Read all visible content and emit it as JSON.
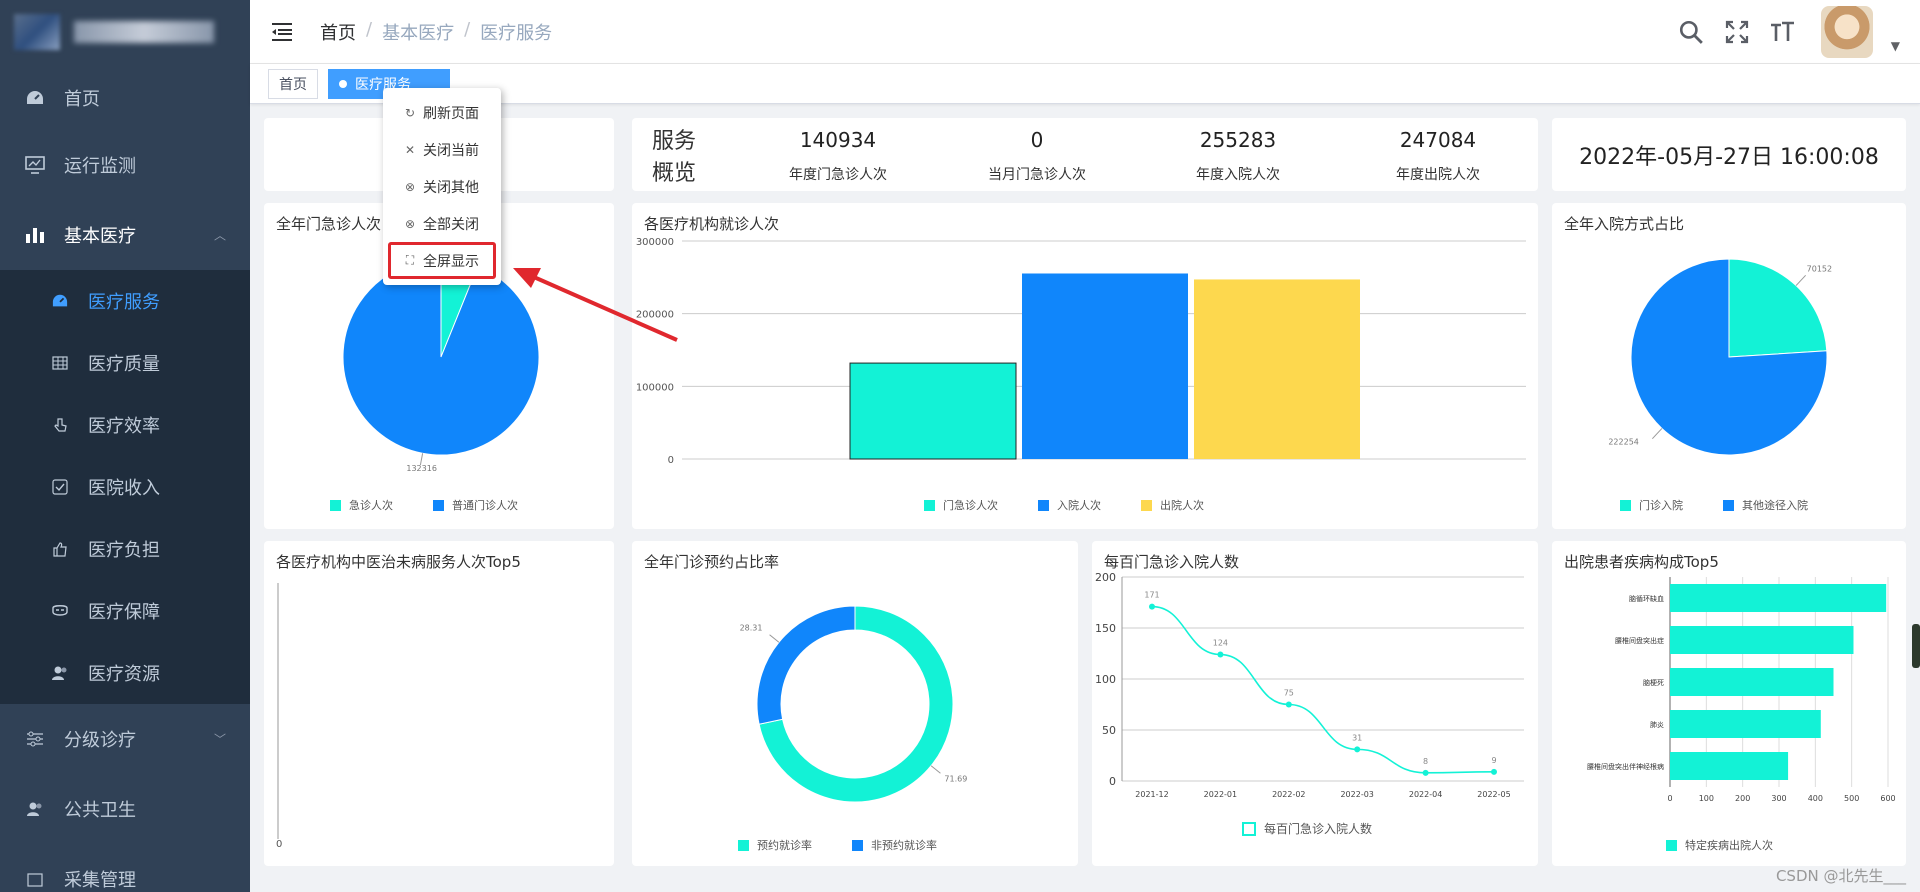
{
  "sidebar": {
    "items": [
      {
        "label": "首页"
      },
      {
        "label": "运行监测"
      },
      {
        "label": "基本医疗"
      },
      {
        "label": "分级诊疗"
      },
      {
        "label": "公共卫生"
      },
      {
        "label": "采集管理"
      }
    ],
    "submenu": [
      {
        "label": "医疗服务"
      },
      {
        "label": "医疗质量"
      },
      {
        "label": "医疗效率"
      },
      {
        "label": "医院收入"
      },
      {
        "label": "医疗负担"
      },
      {
        "label": "医疗保障"
      },
      {
        "label": "医疗资源"
      }
    ]
  },
  "header": {
    "breadcrumb": [
      "首页",
      "基本医疗",
      "医疗服务"
    ],
    "sep": "/"
  },
  "tags": [
    {
      "label": "首页"
    },
    {
      "label": "医疗服务"
    }
  ],
  "context_menu": [
    {
      "label": "刷新页面",
      "icon": "refresh-icon"
    },
    {
      "label": "关闭当前",
      "icon": "close-icon"
    },
    {
      "label": "关闭其他",
      "icon": "circle-close-icon"
    },
    {
      "label": "全部关闭",
      "icon": "circle-close-icon"
    },
    {
      "label": "全屏显示",
      "icon": "fullscreen-icon"
    }
  ],
  "overview": {
    "title": "服务概览",
    "stats": [
      {
        "value": "140934",
        "label": "年度门急诊人次"
      },
      {
        "value": "0",
        "label": "当月门急诊人次"
      },
      {
        "value": "255283",
        "label": "年度入院人次"
      },
      {
        "value": "247084",
        "label": "年度出院人次"
      }
    ]
  },
  "datetime": "2022年-05月-27日 16:00:08",
  "cards": {
    "c1": "全年门急诊人次占比",
    "c2": "各医疗机构就诊人次",
    "c3": "全年入院方式占比",
    "c4": "各医疗机构中医治未病服务人次Top5",
    "c5": "全年门诊预约占比率",
    "c6": "每百门急诊入院人数",
    "c7": "出院患者疾病构成Top5"
  },
  "chart_data": [
    {
      "type": "pie",
      "title": "全年门急诊人次占比",
      "labels": [
        "急诊人次",
        "普通门诊人次"
      ],
      "values": [
        8618,
        132316
      ],
      "label_shown": "132316",
      "colors": [
        "#13f2d6",
        "#1086fb"
      ]
    },
    {
      "type": "bar",
      "title": "各医疗机构就诊人次",
      "categories": [
        ""
      ],
      "series": [
        {
          "name": "门急诊人次",
          "values": [
            132000
          ]
        },
        {
          "name": "入院人次",
          "values": [
            255283
          ]
        },
        {
          "name": "出院人次",
          "values": [
            247084
          ]
        }
      ],
      "ylim": [
        0,
        300000
      ],
      "yticks": [
        "300000",
        "200000",
        "100000",
        "0"
      ],
      "colors": [
        "#13f2d6",
        "#1086fb",
        "#fdd84e"
      ]
    },
    {
      "type": "pie",
      "title": "全年入院方式占比",
      "labels": [
        "门诊入院",
        "其他途径入院"
      ],
      "values": [
        70152,
        222254
      ],
      "value_labels": [
        "70152",
        "222254"
      ],
      "colors": [
        "#13f2d6",
        "#1086fb"
      ]
    },
    {
      "type": "bar",
      "title": "各医疗机构中医治未病服务人次Top5",
      "values": [],
      "yticks": [
        "0"
      ]
    },
    {
      "type": "pie",
      "title": "全年门诊预约占比率",
      "labels": [
        "预约就诊率",
        "非预约就诊率"
      ],
      "values": [
        71.69,
        28.31
      ],
      "value_labels": [
        "71.69",
        "28.31"
      ],
      "colors": [
        "#13f2d6",
        "#1086fb"
      ]
    },
    {
      "type": "line",
      "title": "每百门急诊入院人数",
      "x": [
        "2021-12",
        "2022-01",
        "2022-02",
        "2022-03",
        "2022-04",
        "2022-05"
      ],
      "series": [
        {
          "name": "每百门急诊入院人数",
          "values": [
            171,
            124,
            75,
            31,
            8,
            9
          ]
        }
      ],
      "ylim": [
        0,
        200
      ],
      "yticks": [
        "200",
        "150",
        "100",
        "50",
        "0"
      ],
      "color": "#13f2d6"
    },
    {
      "type": "bar",
      "title": "出院患者疾病构成Top5",
      "orientation": "horizontal",
      "categories": [
        "脑循环缺血",
        "腰椎间盘突出症",
        "脑梗死",
        "肺炎",
        "腰椎间盘突出伴神经根病"
      ],
      "series": [
        {
          "name": "特定疾病出院人次",
          "values": [
            595,
            505,
            450,
            415,
            325
          ]
        }
      ],
      "xlim": [
        0,
        600
      ],
      "xticks": [
        "0",
        "100",
        "200",
        "300",
        "400",
        "500",
        "600"
      ],
      "color": "#13f2d6"
    }
  ],
  "watermark": "CSDN @北先生___"
}
